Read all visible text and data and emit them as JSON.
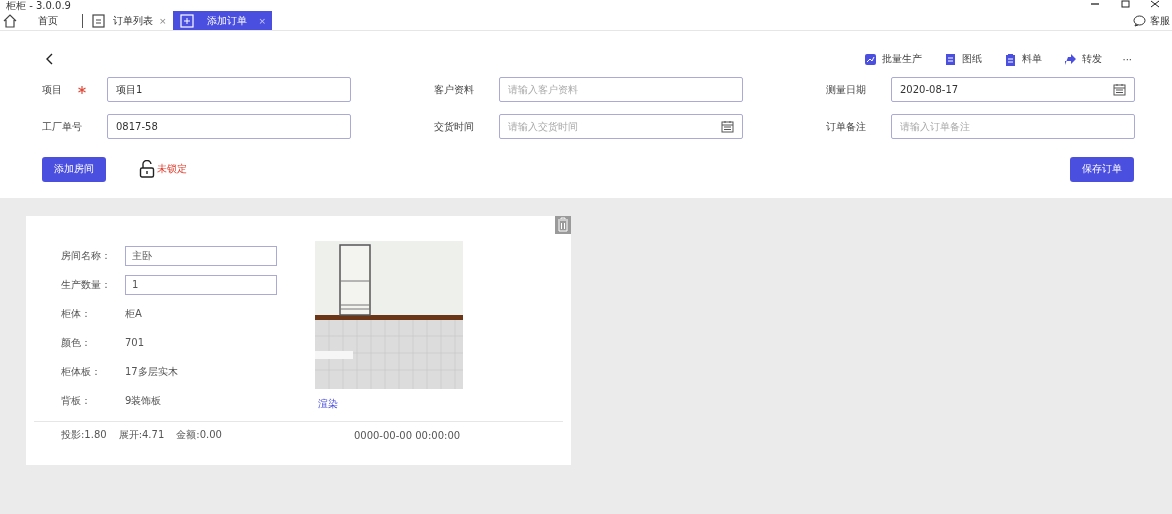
{
  "window": {
    "title": "柜柜 - 3.0.0.9"
  },
  "tabs": [
    {
      "label": "首页",
      "kind": "home",
      "selected": false
    },
    {
      "label": "订单列表",
      "kind": "list",
      "selected": false,
      "close": "×"
    },
    {
      "label": "添加订单",
      "kind": "add",
      "selected": true,
      "close": "×"
    }
  ],
  "support": {
    "label": "客服"
  },
  "toolbar": {
    "actions": [
      {
        "label": "批量生产",
        "kind": "batch"
      },
      {
        "label": "图纸",
        "kind": "drawing"
      },
      {
        "label": "料单",
        "kind": "clipboard"
      },
      {
        "label": "转发",
        "kind": "share"
      }
    ],
    "more": "···"
  },
  "form": {
    "fields": [
      {
        "label": "项目",
        "required": true,
        "value": "项目1",
        "kind": "text"
      },
      {
        "label": "客户资料",
        "required": false,
        "placeholder": "请输入客户资料",
        "kind": "text"
      },
      {
        "label": "测量日期",
        "required": false,
        "value": "2020-08-17",
        "kind": "date"
      },
      {
        "label": "工厂单号",
        "required": false,
        "value": "0817-58",
        "kind": "text"
      },
      {
        "label": "交货时间",
        "required": false,
        "placeholder": "请输入交货时间",
        "kind": "date"
      },
      {
        "label": "订单备注",
        "required": false,
        "placeholder": "请输入订单备注",
        "kind": "text"
      }
    ]
  },
  "add_room": "添加房间",
  "lock": {
    "locked": false,
    "label": "未锁定"
  },
  "save": "保存订单",
  "rooms": [
    {
      "fields": [
        {
          "label": "房间名称：",
          "value": "主卧",
          "kind": "input"
        },
        {
          "label": "生产数量：",
          "value": "1",
          "kind": "input"
        },
        {
          "label": "柜体：",
          "value": "柜A",
          "kind": "text"
        },
        {
          "label": "颜色：",
          "value": "701",
          "kind": "text"
        },
        {
          "label": "柜体板：",
          "value": "17多层实木",
          "kind": "text"
        },
        {
          "label": "背板：",
          "value": "9装饰板",
          "kind": "text"
        }
      ],
      "render_link": "渲染",
      "summary": [
        "投影:1.80",
        "展开:4.71",
        "金额:0.00"
      ],
      "time": "0000-00-00 00:00:00"
    }
  ]
}
